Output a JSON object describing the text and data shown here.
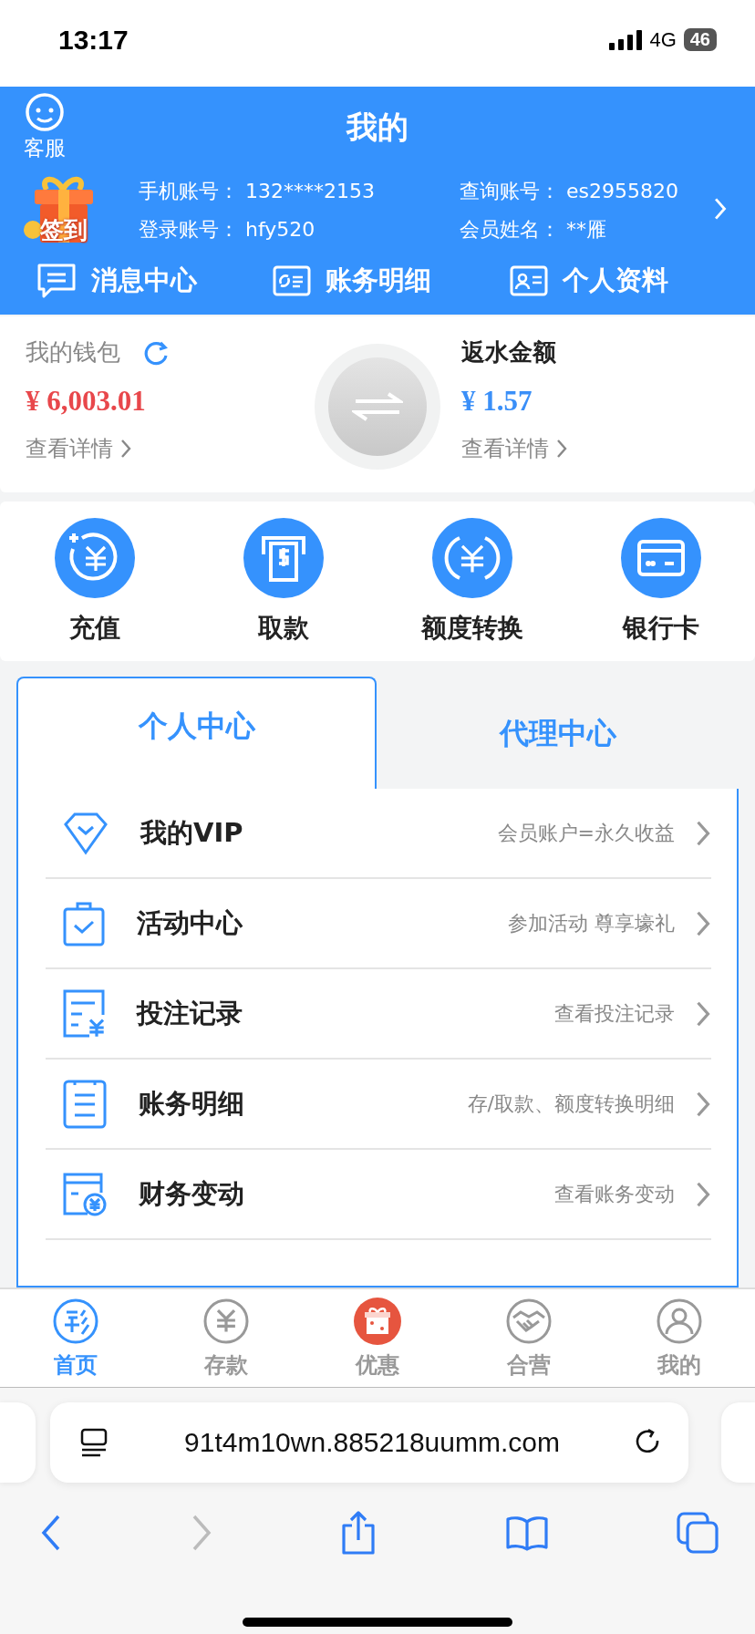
{
  "status_bar": {
    "time": "13:17",
    "network": "4G",
    "battery": "46"
  },
  "header": {
    "title": "我的",
    "service_label": "客服",
    "checkin_label": "签到",
    "account_fields": [
      {
        "label": "手机账号：",
        "value": "132****2153"
      },
      {
        "label": "查询账号：",
        "value": "es2955820"
      },
      {
        "label": "登录账号：",
        "value": "hfy520"
      },
      {
        "label": "会员姓名：",
        "value": "**雁"
      }
    ],
    "quick_links": [
      {
        "label": "消息中心"
      },
      {
        "label": "账务明细"
      },
      {
        "label": "个人资料"
      }
    ]
  },
  "wallets": [
    {
      "label": "我的钱包",
      "amount": "¥ 6,003.01",
      "link": "查看详情",
      "color": "#e8474b"
    },
    {
      "label": "返水金额",
      "amount": "¥ 1.57",
      "link": "查看详情",
      "color": "#3a8ff8"
    }
  ],
  "actions": [
    {
      "label": "充值"
    },
    {
      "label": "取款"
    },
    {
      "label": "额度转换"
    },
    {
      "label": "银行卡"
    }
  ],
  "tabs": [
    {
      "label": "个人中心",
      "selected": true
    },
    {
      "label": "代理中心",
      "selected": false
    }
  ],
  "menu_items": [
    {
      "title": "我的VIP",
      "subtitle": "会员账户=永久收益"
    },
    {
      "title": "活动中心",
      "subtitle": "参加活动 尊享壕礼"
    },
    {
      "title": "投注记录",
      "subtitle": "查看投注记录"
    },
    {
      "title": "账务明细",
      "subtitle": "存/取款、额度转换明细"
    },
    {
      "title": "财务变动",
      "subtitle": "查看账务变动"
    }
  ],
  "bottom_nav": [
    {
      "label": "首页",
      "selected": true
    },
    {
      "label": "存款",
      "selected": false
    },
    {
      "label": "优惠",
      "selected": false
    },
    {
      "label": "合营",
      "selected": false
    },
    {
      "label": "我的",
      "selected": false
    }
  ],
  "browser": {
    "url": "91t4m10wn.885218uumm.com"
  }
}
